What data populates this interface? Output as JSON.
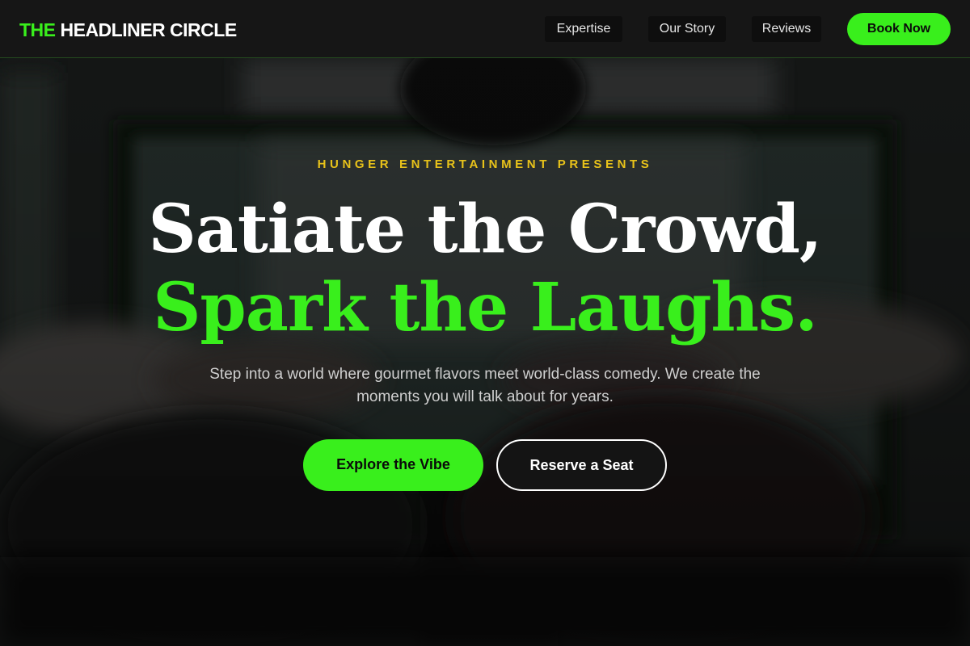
{
  "header": {
    "logo_accent": "THE",
    "logo_rest": "HEADLINER CIRCLE",
    "nav": [
      {
        "label": "Expertise"
      },
      {
        "label": "Our Story"
      },
      {
        "label": "Reviews"
      }
    ],
    "cta_label": "Book Now"
  },
  "hero": {
    "eyebrow": "HUNGER ENTERTAINMENT PRESENTS",
    "headline_line1": "Satiate the Crowd,",
    "headline_line2": "Spark the Laughs.",
    "subtext": "Step into a world where gourmet flavors meet world-class comedy. We create the moments you will talk about for years.",
    "primary_cta": "Explore the Vibe",
    "secondary_cta": "Reserve a Seat",
    "background_image": "blurred-tv-audience-photo"
  },
  "colors": {
    "accent": "#39ef1c",
    "eyebrow": "#e8c21a",
    "header_bg": "#161616",
    "text": "#ffffff"
  }
}
